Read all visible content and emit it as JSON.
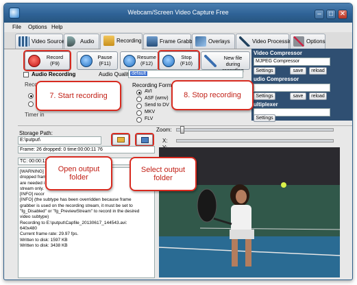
{
  "window": {
    "title": "Webcam/Screen Video Capture Free"
  },
  "menu": [
    "File",
    "Options",
    "Help"
  ],
  "tabs": [
    {
      "label": "Video Source",
      "icon": "film-strip-icon"
    },
    {
      "label": "Audio",
      "icon": "speaker-icon"
    },
    {
      "label": "Recording",
      "icon": "record-folder-icon"
    },
    {
      "label": "Frame Grabber",
      "icon": "frame-grabber-icon"
    },
    {
      "label": "Overlays",
      "icon": "overlay-icon"
    },
    {
      "label": "Video Processing",
      "icon": "wand-icon"
    },
    {
      "label": "Options",
      "icon": "tools-icon"
    }
  ],
  "active_tab": "Recording",
  "controls": {
    "record": {
      "label": "Record",
      "key": "(F9)"
    },
    "pause": {
      "label": "Pause",
      "key": "(F11)"
    },
    "resume": {
      "label": "Resume",
      "key": "(F12)"
    },
    "stop": {
      "label": "Stop",
      "key": "(F10)"
    },
    "new_file": {
      "label": "New file during recording"
    }
  },
  "audio": {
    "checkbox_label": "Audio Recording",
    "quality_label": "Audio Quality:",
    "quality_value": "default"
  },
  "recording": {
    "group_label": "Recor",
    "timer_label": "Timer in",
    "format_title": "Recording Format",
    "formats": [
      "AVI",
      "ASF (wmv)",
      "Send to DV",
      "MKV",
      "FLV"
    ],
    "selected_format": "AVI"
  },
  "video_compressor": {
    "title": "Video Compressor",
    "value": "MJPEG Compressor",
    "settings": "Settings",
    "save": "save",
    "reload": "reload"
  },
  "audio_compressor": {
    "title": "udio Compressor",
    "settings": "Settings",
    "save": "save",
    "reload": "reload"
  },
  "multiplexer": {
    "title": "ultiplexer",
    "settings": "Settings"
  },
  "storage": {
    "label": "Storage Path:",
    "path": "E:\\putput\\"
  },
  "status": {
    "frames": "Frame: 26 dropped: 0 time:00:00:11 76",
    "tc": "TC: 00:00:11"
  },
  "log": [
    "[WARNING]",
    "dropped fram",
    "are needed i",
    "stream only.",
    "[INFO] recor",
    "[INFO] (the subtype has been overridden because frame",
    "grabber is used on the recording stream, it must be set to",
    "\"fg_Disabled\" or \"fg_PreviewStream\" to record in the desired",
    "video subtype)",
    "Recording to E:\\putput\\Capfile_20130617_144543.avi:",
    "640x480",
    "Current frame rate: 29.97 fps.",
    "Written to disk: 1597 KB",
    "Written to disk: 3438 KB"
  ],
  "preview": {
    "zoom_label": "Zoom:",
    "x_label": "X:",
    "y_label": "Y:"
  },
  "callouts": {
    "start": "7. Start recording",
    "stop": "8. Stop recording",
    "open_folder": "Open output folder",
    "select_folder": "Select output folder"
  },
  "colors": {
    "accent": "#2f6296",
    "callout_border": "#d82a1f",
    "callout_text": "#c11e14",
    "record_red": "#d41b1b"
  }
}
